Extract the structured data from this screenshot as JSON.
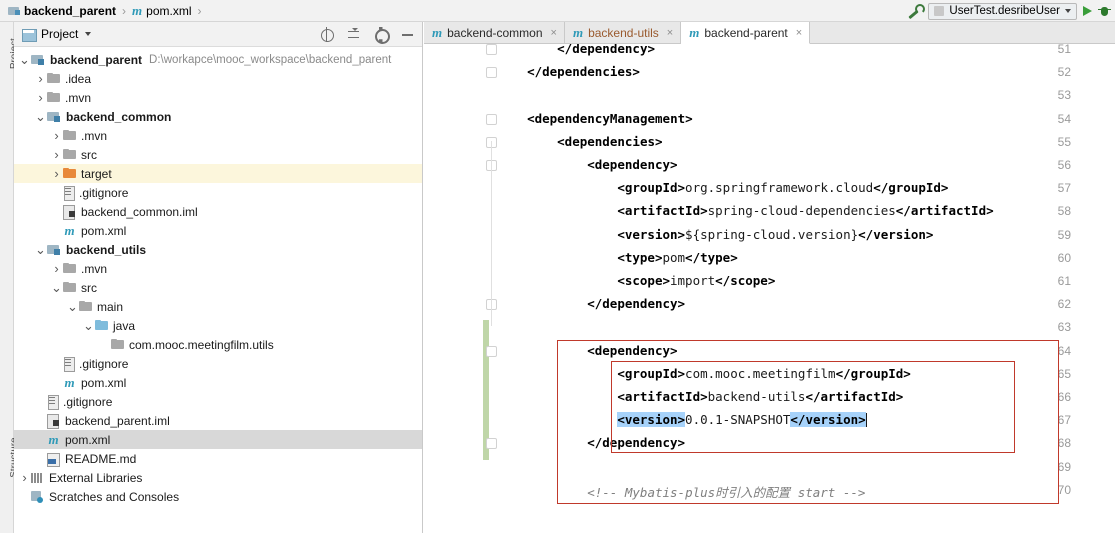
{
  "breadcrumb": {
    "items": [
      {
        "label": "backend_parent",
        "icon": "module-icon",
        "bold": true
      },
      {
        "label": "pom.xml",
        "icon": "maven-m-icon",
        "bold": false
      }
    ],
    "separator": "›"
  },
  "toolbar": {
    "build_icon": "wrench-icon",
    "run_config": "UserTest.desribeUser",
    "run_icon": "run-play-icon",
    "debug_icon": "debug-bug-icon"
  },
  "left_strip": {
    "project_label": "Project",
    "structure_label": "Structure"
  },
  "project_panel": {
    "title": "Project",
    "icons": [
      "locate-icon",
      "collapse-all-icon",
      "settings-gear-icon",
      "minimize-icon"
    ],
    "tree": [
      {
        "depth": 0,
        "arrow": "v",
        "icon": "module-icon",
        "label": "backend_parent",
        "bold": true,
        "path": "D:\\workapce\\mooc_workspace\\backend_parent",
        "state": "normal"
      },
      {
        "depth": 1,
        "arrow": ">",
        "icon": "folder-icon",
        "label": ".idea",
        "bold": false,
        "path": "",
        "state": "normal"
      },
      {
        "depth": 1,
        "arrow": ">",
        "icon": "folder-icon",
        "label": ".mvn",
        "bold": false,
        "path": "",
        "state": "normal"
      },
      {
        "depth": 1,
        "arrow": "v",
        "icon": "module-icon",
        "label": "backend_common",
        "bold": true,
        "path": "",
        "state": "normal"
      },
      {
        "depth": 2,
        "arrow": ">",
        "icon": "folder-icon",
        "label": ".mvn",
        "bold": false,
        "path": "",
        "state": "normal"
      },
      {
        "depth": 2,
        "arrow": ">",
        "icon": "folder-icon",
        "label": "src",
        "bold": false,
        "path": "",
        "state": "normal"
      },
      {
        "depth": 2,
        "arrow": ">",
        "icon": "folder-orange-icon",
        "label": "target",
        "bold": false,
        "path": "",
        "state": "highlight"
      },
      {
        "depth": 2,
        "arrow": "",
        "icon": "file-icon",
        "label": ".gitignore",
        "bold": false,
        "path": "",
        "state": "normal"
      },
      {
        "depth": 2,
        "arrow": "",
        "icon": "iml-icon",
        "label": "backend_common.iml",
        "bold": false,
        "path": "",
        "state": "normal"
      },
      {
        "depth": 2,
        "arrow": "",
        "icon": "maven-m-icon",
        "label": "pom.xml",
        "bold": false,
        "path": "",
        "state": "normal"
      },
      {
        "depth": 1,
        "arrow": "v",
        "icon": "module-icon",
        "label": "backend_utils",
        "bold": true,
        "path": "",
        "state": "normal"
      },
      {
        "depth": 2,
        "arrow": ">",
        "icon": "folder-icon",
        "label": ".mvn",
        "bold": false,
        "path": "",
        "state": "normal"
      },
      {
        "depth": 2,
        "arrow": "v",
        "icon": "folder-icon",
        "label": "src",
        "bold": false,
        "path": "",
        "state": "normal"
      },
      {
        "depth": 3,
        "arrow": "v",
        "icon": "folder-icon",
        "label": "main",
        "bold": false,
        "path": "",
        "state": "normal"
      },
      {
        "depth": 4,
        "arrow": "v",
        "icon": "folder-blue-icon",
        "label": "java",
        "bold": false,
        "path": "",
        "state": "normal"
      },
      {
        "depth": 5,
        "arrow": "",
        "icon": "folder-icon",
        "label": "com.mooc.meetingfilm.utils",
        "bold": false,
        "path": "",
        "state": "normal"
      },
      {
        "depth": 2,
        "arrow": "",
        "icon": "file-icon",
        "label": ".gitignore",
        "bold": false,
        "path": "",
        "state": "normal"
      },
      {
        "depth": 2,
        "arrow": "",
        "icon": "maven-m-icon",
        "label": "pom.xml",
        "bold": false,
        "path": "",
        "state": "normal"
      },
      {
        "depth": 1,
        "arrow": "",
        "icon": "file-icon",
        "label": ".gitignore",
        "bold": false,
        "path": "",
        "state": "normal"
      },
      {
        "depth": 1,
        "arrow": "",
        "icon": "iml-icon",
        "label": "backend_parent.iml",
        "bold": false,
        "path": "",
        "state": "normal"
      },
      {
        "depth": 1,
        "arrow": "",
        "icon": "maven-m-icon",
        "label": "pom.xml",
        "bold": false,
        "path": "",
        "state": "selected"
      },
      {
        "depth": 1,
        "arrow": "",
        "icon": "markdown-icon",
        "label": "README.md",
        "bold": false,
        "path": "",
        "state": "normal"
      },
      {
        "depth": 0,
        "arrow": ">",
        "icon": "library-icon",
        "label": "External Libraries",
        "bold": false,
        "path": "",
        "state": "normal"
      },
      {
        "depth": 0,
        "arrow": "",
        "icon": "scratch-icon",
        "label": "Scratches and Consoles",
        "bold": false,
        "path": "",
        "state": "normal"
      }
    ]
  },
  "editor": {
    "tabs": [
      {
        "label": "backend-common",
        "active": false,
        "style": "normal",
        "icon": "maven-m-icon",
        "close": "×"
      },
      {
        "label": "backend-utils",
        "active": false,
        "style": "modified",
        "icon": "maven-m-icon",
        "close": "×"
      },
      {
        "label": "backend-parent",
        "active": true,
        "style": "normal",
        "icon": "maven-m-icon",
        "close": "×"
      }
    ],
    "file": "pom.xml",
    "lines": [
      {
        "n": "51",
        "indent": 8,
        "segs": [
          {
            "t": "</dependency>",
            "c": "tag"
          }
        ]
      },
      {
        "n": "52",
        "indent": 4,
        "segs": [
          {
            "t": "</dependencies>",
            "c": "tag"
          }
        ]
      },
      {
        "n": "53",
        "indent": 0,
        "segs": []
      },
      {
        "n": "54",
        "indent": 4,
        "segs": [
          {
            "t": "<dependencyManagement>",
            "c": "tag"
          }
        ]
      },
      {
        "n": "55",
        "indent": 8,
        "segs": [
          {
            "t": "<dependencies>",
            "c": "tag"
          }
        ]
      },
      {
        "n": "56",
        "indent": 12,
        "segs": [
          {
            "t": "<dependency>",
            "c": "tag"
          }
        ]
      },
      {
        "n": "57",
        "indent": 16,
        "segs": [
          {
            "t": "<groupId>",
            "c": "tag"
          },
          {
            "t": "org.springframework.cloud",
            "c": "txt"
          },
          {
            "t": "</groupId>",
            "c": "tag"
          }
        ]
      },
      {
        "n": "58",
        "indent": 16,
        "segs": [
          {
            "t": "<artifactId>",
            "c": "tag"
          },
          {
            "t": "spring-cloud-dependencies",
            "c": "txt"
          },
          {
            "t": "</artifactId>",
            "c": "tag"
          }
        ]
      },
      {
        "n": "59",
        "indent": 16,
        "segs": [
          {
            "t": "<version>",
            "c": "tag"
          },
          {
            "t": "${spring-cloud.version}",
            "c": "txt"
          },
          {
            "t": "</version>",
            "c": "tag"
          }
        ]
      },
      {
        "n": "60",
        "indent": 16,
        "segs": [
          {
            "t": "<type>",
            "c": "tag"
          },
          {
            "t": "pom",
            "c": "txt"
          },
          {
            "t": "</type>",
            "c": "tag"
          }
        ]
      },
      {
        "n": "61",
        "indent": 16,
        "segs": [
          {
            "t": "<scope>",
            "c": "tag"
          },
          {
            "t": "import",
            "c": "txt"
          },
          {
            "t": "</scope>",
            "c": "tag"
          }
        ]
      },
      {
        "n": "62",
        "indent": 12,
        "segs": [
          {
            "t": "</dependency>",
            "c": "tag"
          }
        ]
      },
      {
        "n": "63",
        "indent": 0,
        "segs": []
      },
      {
        "n": "64",
        "indent": 12,
        "segs": [
          {
            "t": "<dependency>",
            "c": "tag"
          }
        ]
      },
      {
        "n": "65",
        "indent": 16,
        "segs": [
          {
            "t": "<groupId>",
            "c": "tag"
          },
          {
            "t": "com.mooc.meetingfilm",
            "c": "txt"
          },
          {
            "t": "</groupId>",
            "c": "tag"
          }
        ]
      },
      {
        "n": "66",
        "indent": 16,
        "segs": [
          {
            "t": "<artifactId>",
            "c": "tag"
          },
          {
            "t": "backend-utils",
            "c": "txt"
          },
          {
            "t": "</artifactId>",
            "c": "tag"
          }
        ]
      },
      {
        "n": "67",
        "indent": 16,
        "segs": [
          {
            "t": "<version>",
            "c": "tag sel"
          },
          {
            "t": "0.0.1-SNAPSHOT",
            "c": "txt"
          },
          {
            "t": "</version>",
            "c": "tag sel"
          },
          {
            "t": "",
            "c": "caret"
          }
        ]
      },
      {
        "n": "68",
        "indent": 12,
        "segs": [
          {
            "t": "</dependency>",
            "c": "tag"
          }
        ]
      },
      {
        "n": "69",
        "indent": 0,
        "segs": []
      },
      {
        "n": "70",
        "indent": 12,
        "segs": [
          {
            "t": "<!-- Mybatis-plus时引入的配置 start -->",
            "c": "comment"
          }
        ]
      }
    ],
    "annotations": {
      "outer_box_color": "#c0392b",
      "inner_box_color": "#c0392b",
      "selection_color": "#a6d2fa",
      "changebar_color": "#bfd6a8",
      "current_line_color": "#fcf6dc"
    }
  }
}
